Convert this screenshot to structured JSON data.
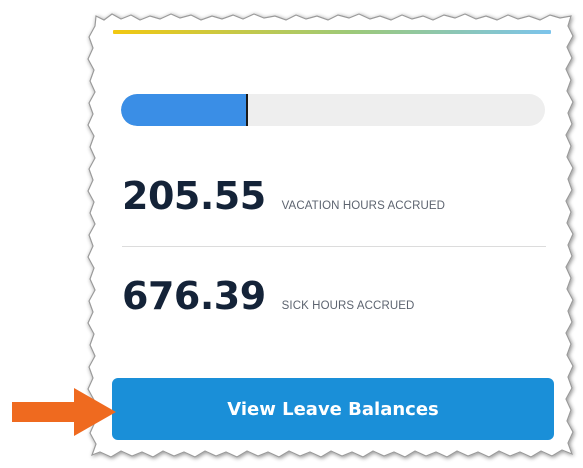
{
  "leave_card": {
    "progress": {
      "fill_fraction": 0.3,
      "fill_color": "#3a8ee6",
      "track_color": "#eeeeee"
    },
    "vacation": {
      "value": "205.55",
      "label": "VACATION HOURS ACCRUED"
    },
    "sick": {
      "value": "676.39",
      "label": "SICK HOURS ACCRUED"
    },
    "view_button_label": "View Leave Balances",
    "colors": {
      "accent_start": "#f2c811",
      "accent_mid": "#9cc97a",
      "accent_end": "#7cc4ec",
      "button": "#1a8fd8",
      "arrow": "#ef6a1f",
      "value_text": "#142338"
    }
  },
  "annotation": {
    "arrow_icon": "orange-arrow-right-icon"
  }
}
